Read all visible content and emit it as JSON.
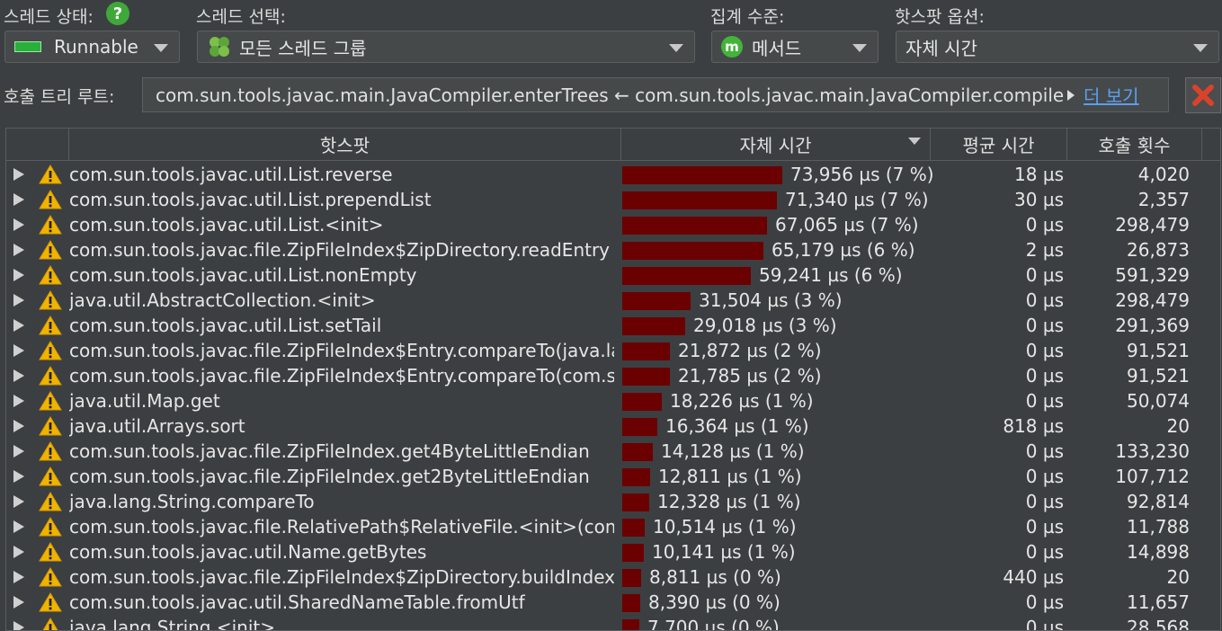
{
  "toolbar": {
    "thread_state_label": "스레드 상태:",
    "thread_state_value": "Runnable",
    "thread_select_label": "스레드 선택:",
    "thread_select_value": "모든 스레드 그룹",
    "aggregation_label": "집계 수준:",
    "aggregation_value": "메서드",
    "hotspot_options_label": "핫스팟 옵션:",
    "hotspot_options_value": "자체 시간"
  },
  "call_tree_root": {
    "label": "호출 트리 루트:",
    "path": "com.sun.tools.javac.main.JavaCompiler.enterTrees ← com.sun.tools.javac.main.JavaCompiler.compile ← com.sun.tools.javac.main.Main.compile",
    "more_link": "더 보기"
  },
  "table": {
    "headers": [
      "핫스팟",
      "자체 시간",
      "평균 시간",
      "호출 횟수"
    ],
    "rows": [
      {
        "name": "com.sun.tools.javac.util.List.reverse",
        "self": "73,956 µs (7 %)",
        "bar": 1.0,
        "avg": "18 µs",
        "calls": "4,020"
      },
      {
        "name": "com.sun.tools.javac.util.List.prependList",
        "self": "71,340 µs (7 %)",
        "bar": 0.965,
        "avg": "30 µs",
        "calls": "2,357"
      },
      {
        "name": "com.sun.tools.javac.util.List.<init>",
        "self": "67,065 µs (7 %)",
        "bar": 0.907,
        "avg": "0 µs",
        "calls": "298,479"
      },
      {
        "name": "com.sun.tools.javac.file.ZipFileIndex$ZipDirectory.readEntry",
        "self": "65,179 µs (6 %)",
        "bar": 0.881,
        "avg": "2 µs",
        "calls": "26,873"
      },
      {
        "name": "com.sun.tools.javac.util.List.nonEmpty",
        "self": "59,241 µs (6 %)",
        "bar": 0.801,
        "avg": "0 µs",
        "calls": "591,329"
      },
      {
        "name": "java.util.AbstractCollection.<init>",
        "self": "31,504 µs (3 %)",
        "bar": 0.426,
        "avg": "0 µs",
        "calls": "298,479"
      },
      {
        "name": "com.sun.tools.javac.util.List.setTail",
        "self": "29,018 µs (3 %)",
        "bar": 0.392,
        "avg": "0 µs",
        "calls": "291,369"
      },
      {
        "name": "com.sun.tools.javac.file.ZipFileIndex$Entry.compareTo(java.lang....",
        "self": "21,872 µs (2 %)",
        "bar": 0.296,
        "avg": "0 µs",
        "calls": "91,521"
      },
      {
        "name": "com.sun.tools.javac.file.ZipFileIndex$Entry.compareTo(com.sun....",
        "self": "21,785 µs (2 %)",
        "bar": 0.295,
        "avg": "0 µs",
        "calls": "91,521"
      },
      {
        "name": "java.util.Map.get",
        "self": "18,226 µs (1 %)",
        "bar": 0.246,
        "avg": "0 µs",
        "calls": "50,074"
      },
      {
        "name": "java.util.Arrays.sort",
        "self": "16,364 µs (1 %)",
        "bar": 0.221,
        "avg": "818 µs",
        "calls": "20"
      },
      {
        "name": "com.sun.tools.javac.file.ZipFileIndex.get4ByteLittleEndian",
        "self": "14,128 µs (1 %)",
        "bar": 0.191,
        "avg": "0 µs",
        "calls": "133,230"
      },
      {
        "name": "com.sun.tools.javac.file.ZipFileIndex.get2ByteLittleEndian",
        "self": "12,811 µs (1 %)",
        "bar": 0.173,
        "avg": "0 µs",
        "calls": "107,712"
      },
      {
        "name": "java.lang.String.compareTo",
        "self": "12,328 µs (1 %)",
        "bar": 0.167,
        "avg": "0 µs",
        "calls": "92,814"
      },
      {
        "name": "com.sun.tools.javac.file.RelativePath$RelativeFile.<init>(com.su...",
        "self": "10,514 µs (1 %)",
        "bar": 0.142,
        "avg": "0 µs",
        "calls": "11,788"
      },
      {
        "name": "com.sun.tools.javac.util.Name.getBytes",
        "self": "10,141 µs (1 %)",
        "bar": 0.137,
        "avg": "0 µs",
        "calls": "14,898"
      },
      {
        "name": "com.sun.tools.javac.file.ZipFileIndex$ZipDirectory.buildIndex",
        "self": "8,811 µs (0 %)",
        "bar": 0.119,
        "avg": "440 µs",
        "calls": "20"
      },
      {
        "name": "com.sun.tools.javac.util.SharedNameTable.fromUtf",
        "self": "8,390 µs (0 %)",
        "bar": 0.113,
        "avg": "0 µs",
        "calls": "11,657"
      },
      {
        "name": "java.lang.String.<init>",
        "self": "7,700 µs (0 %)",
        "bar": 0.104,
        "avg": "0 µs",
        "calls": "28,568"
      }
    ]
  },
  "colors": {
    "bar": "#6b0000",
    "status_green": "#27b13a",
    "link": "#5b9ef0",
    "warning": "#f0b400"
  }
}
